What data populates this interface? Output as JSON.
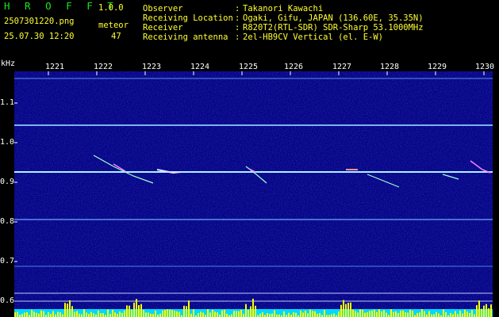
{
  "header": {
    "app_name": "H R O F F T",
    "version": "1.0.0",
    "filename": "2507301220.png",
    "datetime": "25.07.30 12:20",
    "mode_label": "meteor",
    "meteor_count": "47",
    "fields": [
      {
        "label": "Observer",
        "sep": ":",
        "value": "Takanori Kawachi"
      },
      {
        "label": "Receiving Location",
        "sep": ":",
        "value": "Ogaki, Gifu, JAPAN (136.60E, 35.35N)"
      },
      {
        "label": "Receiver",
        "sep": ":",
        "value": "R820T2(RTL-SDR) SDR-Sharp 53.1000MHz"
      },
      {
        "label": "Receiving antenna",
        "sep": ":",
        "value": "2el-HB9CV Vertical (el. E-W)"
      }
    ]
  },
  "axis": {
    "y_unit": "kHz",
    "y_ticks": [
      "1.1",
      "1.0",
      "0.9",
      "0.8",
      "0.7",
      "0.6"
    ],
    "x_ticks": [
      "1221",
      "1222",
      "1223",
      "1224",
      "1225",
      "1226",
      "1227",
      "1228",
      "1229",
      "1230"
    ]
  },
  "colors": {
    "background": "#000000",
    "spectrogram_base": "#050580",
    "label_green": "#18e818",
    "label_yellow": "#ffff33",
    "label_white": "#ffffff",
    "noise_strip": "#00d8ff",
    "signal_bars": "#ffff00"
  }
}
